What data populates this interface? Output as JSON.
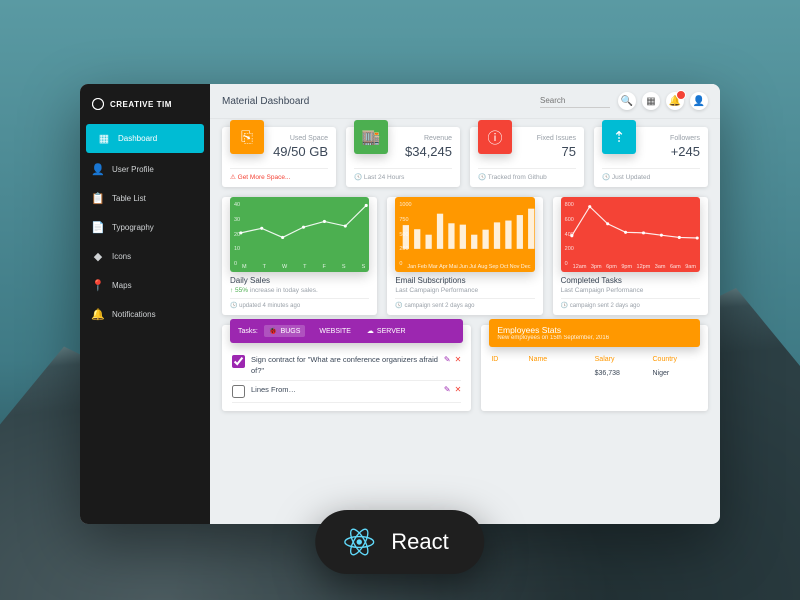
{
  "brand": "CREATIVE TIM",
  "page_title": "Material Dashboard",
  "search_placeholder": "Search",
  "sidebar": [
    {
      "icon": "▦",
      "label": "Dashboard",
      "active": true
    },
    {
      "icon": "👤",
      "label": "User Profile"
    },
    {
      "icon": "📋",
      "label": "Table List"
    },
    {
      "icon": "📄",
      "label": "Typography"
    },
    {
      "icon": "◆",
      "label": "Icons"
    },
    {
      "icon": "📍",
      "label": "Maps"
    },
    {
      "icon": "🔔",
      "label": "Notifications"
    }
  ],
  "stats": [
    {
      "color": "#ff9800",
      "icon": "⎘",
      "label": "Used Space",
      "value": "49/50 GB",
      "footer": "Get More Space...",
      "footer_warn": true
    },
    {
      "color": "#4caf50",
      "icon": "🏬",
      "label": "Revenue",
      "value": "$34,245",
      "footer": "Last 24 Hours"
    },
    {
      "color": "#f44336",
      "icon": "ⓘ",
      "label": "Fixed Issues",
      "value": "75",
      "footer": "Tracked from Github"
    },
    {
      "color": "#00bcd4",
      "icon": "⇡",
      "label": "Followers",
      "value": "+245",
      "footer": "Just Updated"
    }
  ],
  "charts": [
    {
      "title": "Daily Sales",
      "sub_prefix": "↑ 55%",
      "sub": " increase in today sales.",
      "footer": "updated 4 minutes ago"
    },
    {
      "title": "Email Subscriptions",
      "sub": "Last Campaign Performance",
      "footer": "campaign sent 2 days ago"
    },
    {
      "title": "Completed Tasks",
      "sub": "Last Campaign Performance",
      "footer": "campaign sent 2 days ago"
    }
  ],
  "chart_data": [
    {
      "type": "line",
      "title": "Daily Sales",
      "categories": [
        "M",
        "T",
        "W",
        "T",
        "F",
        "S",
        "S"
      ],
      "values": [
        14,
        18,
        10,
        19,
        24,
        20,
        38
      ],
      "ylim": [
        0,
        40
      ]
    },
    {
      "type": "bar",
      "title": "Email Subscriptions",
      "categories": [
        "Jan",
        "Feb",
        "Mar",
        "Apr",
        "Mai",
        "Jun",
        "Jul",
        "Aug",
        "Sep",
        "Oct",
        "Nov",
        "Dec"
      ],
      "values": [
        520,
        430,
        310,
        770,
        560,
        530,
        310,
        420,
        580,
        620,
        740,
        880
      ],
      "ylim": [
        0,
        1000
      ]
    },
    {
      "type": "line",
      "title": "Completed Tasks",
      "categories": [
        "12am",
        "3pm",
        "6pm",
        "9pm",
        "12pm",
        "3am",
        "6am",
        "9am"
      ],
      "values": [
        230,
        740,
        440,
        290,
        280,
        240,
        200,
        190
      ],
      "ylim": [
        0,
        800
      ]
    }
  ],
  "task_panel": {
    "header": "Tasks:",
    "tabs": [
      {
        "icon": "🐞",
        "label": "BUGS",
        "active": true
      },
      {
        "icon": "</>",
        "label": "WEBSITE"
      },
      {
        "icon": "☁",
        "label": "SERVER"
      }
    ],
    "tasks": [
      {
        "done": true,
        "text": "Sign contract for \"What are conference organizers afraid of?\""
      },
      {
        "done": false,
        "text": "Lines From…"
      }
    ]
  },
  "employees": {
    "title": "Employees Stats",
    "subtitle": "New employees on 15th September, 2016",
    "columns": [
      "ID",
      "Name",
      "Salary",
      "Country"
    ],
    "rows": [
      {
        "id": "",
        "name": "",
        "salary": "$36,738",
        "country": "Niger"
      }
    ]
  },
  "overlay_badge": "React"
}
